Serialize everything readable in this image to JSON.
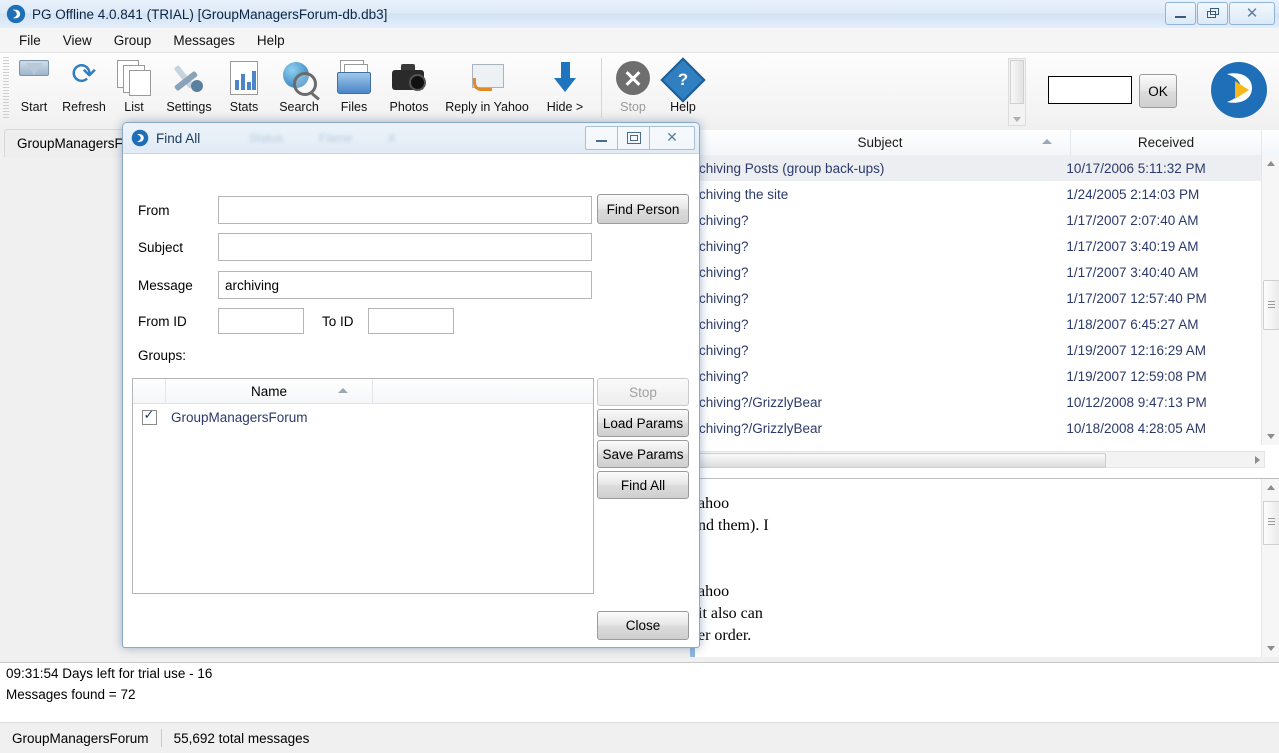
{
  "window": {
    "title": "PG Offline 4.0.841 (TRIAL) [GroupManagersForum-db.db3]",
    "logo_colors": {
      "blue": "#1f6fb8",
      "yellow": "#f5b81a"
    },
    "controls": {
      "minimize": "Minimize",
      "restore": "Restore",
      "close": "Close"
    }
  },
  "menubar": {
    "items": [
      {
        "label": "File"
      },
      {
        "label": "View"
      },
      {
        "label": "Group"
      },
      {
        "label": "Messages"
      },
      {
        "label": "Help"
      }
    ]
  },
  "toolbar": {
    "buttons": [
      {
        "label": "Start",
        "icon": "download-start-icon",
        "enabled": true
      },
      {
        "label": "Refresh",
        "icon": "refresh-icon",
        "enabled": true
      },
      {
        "label": "List",
        "icon": "documents-icon",
        "enabled": true
      },
      {
        "label": "Settings",
        "icon": "tools-icon",
        "enabled": true
      },
      {
        "label": "Stats",
        "icon": "chart-document-icon",
        "enabled": true
      },
      {
        "label": "Search",
        "icon": "globe-magnifier-icon",
        "enabled": true
      },
      {
        "label": "Files",
        "icon": "folder-files-icon",
        "enabled": true
      },
      {
        "label": "Photos",
        "icon": "camera-icon",
        "enabled": true
      },
      {
        "label": "Reply in Yahoo",
        "icon": "reply-envelope-icon",
        "enabled": true
      },
      {
        "label": "Hide >",
        "icon": "down-arrow-icon",
        "enabled": true
      },
      {
        "label": "Stop",
        "icon": "stop-circle-icon",
        "enabled": false
      },
      {
        "label": "Help",
        "icon": "help-diamond-icon",
        "enabled": true
      }
    ],
    "entry_value": "",
    "ok_label": "OK"
  },
  "tabs": [
    {
      "label": "GroupManagersF"
    }
  ],
  "message_list": {
    "columns": [
      {
        "label": "Subject",
        "sort": "ascending"
      },
      {
        "label": "Received",
        "sort": ""
      }
    ],
    "rows": [
      {
        "subject": "chiving Posts (group back-ups)",
        "received": "10/17/2006 5:11:32 PM",
        "selected": true
      },
      {
        "subject": "chiving the site",
        "received": "1/24/2005 2:14:03 PM",
        "selected": false
      },
      {
        "subject": "chiving?",
        "received": "1/17/2007 2:07:40 AM",
        "selected": false
      },
      {
        "subject": "chiving?",
        "received": "1/17/2007 3:40:19 AM",
        "selected": false
      },
      {
        "subject": "chiving?",
        "received": "1/17/2007 3:40:40 AM",
        "selected": false
      },
      {
        "subject": "chiving?",
        "received": "1/17/2007 12:57:40 PM",
        "selected": false
      },
      {
        "subject": "chiving?",
        "received": "1/18/2007 6:45:27 AM",
        "selected": false
      },
      {
        "subject": "chiving?",
        "received": "1/19/2007 12:16:29 AM",
        "selected": false
      },
      {
        "subject": "chiving?",
        "received": "1/19/2007 12:59:08 PM",
        "selected": false
      },
      {
        "subject": "chiving?/GrizzlyBear",
        "received": "10/12/2008 9:47:13 PM",
        "selected": false
      },
      {
        "subject": "chiving?/GrizzlyBear",
        "received": "10/18/2008 4:28:05 AM",
        "selected": false
      }
    ]
  },
  "preview": {
    "lines": [
      "ahoo",
      "nd them). I",
      "",
      "",
      "ahoo",
      "it also can",
      "er order."
    ]
  },
  "log": {
    "lines": [
      "09:31:54 Days left for trial use - 16",
      "Messages found = 72"
    ]
  },
  "statusbar": {
    "group": "GroupManagersForum",
    "total": "55,692 total messages"
  },
  "dialog": {
    "title": "Find All",
    "controls": {
      "minimize": "Minimize",
      "maximize": "Maximize",
      "close": "Close"
    },
    "fields": {
      "from_label": "From",
      "from_value": "",
      "subject_label": "Subject",
      "subject_value": "",
      "message_label": "Message",
      "message_value": "archiving",
      "from_id_label": "From ID",
      "from_id_value": "",
      "to_id_label": "To ID",
      "to_id_value": "",
      "groups_label": "Groups:"
    },
    "grid": {
      "columns": [
        {
          "label": ""
        },
        {
          "label": "Name",
          "sort": "ascending"
        }
      ],
      "rows": [
        {
          "checked": true,
          "name": "GroupManagersForum"
        }
      ]
    },
    "buttons": {
      "find_person": "Find Person",
      "stop": "Stop",
      "load_params": "Load Params",
      "save_params": "Save Params",
      "find_all": "Find All",
      "close": "Close"
    }
  }
}
